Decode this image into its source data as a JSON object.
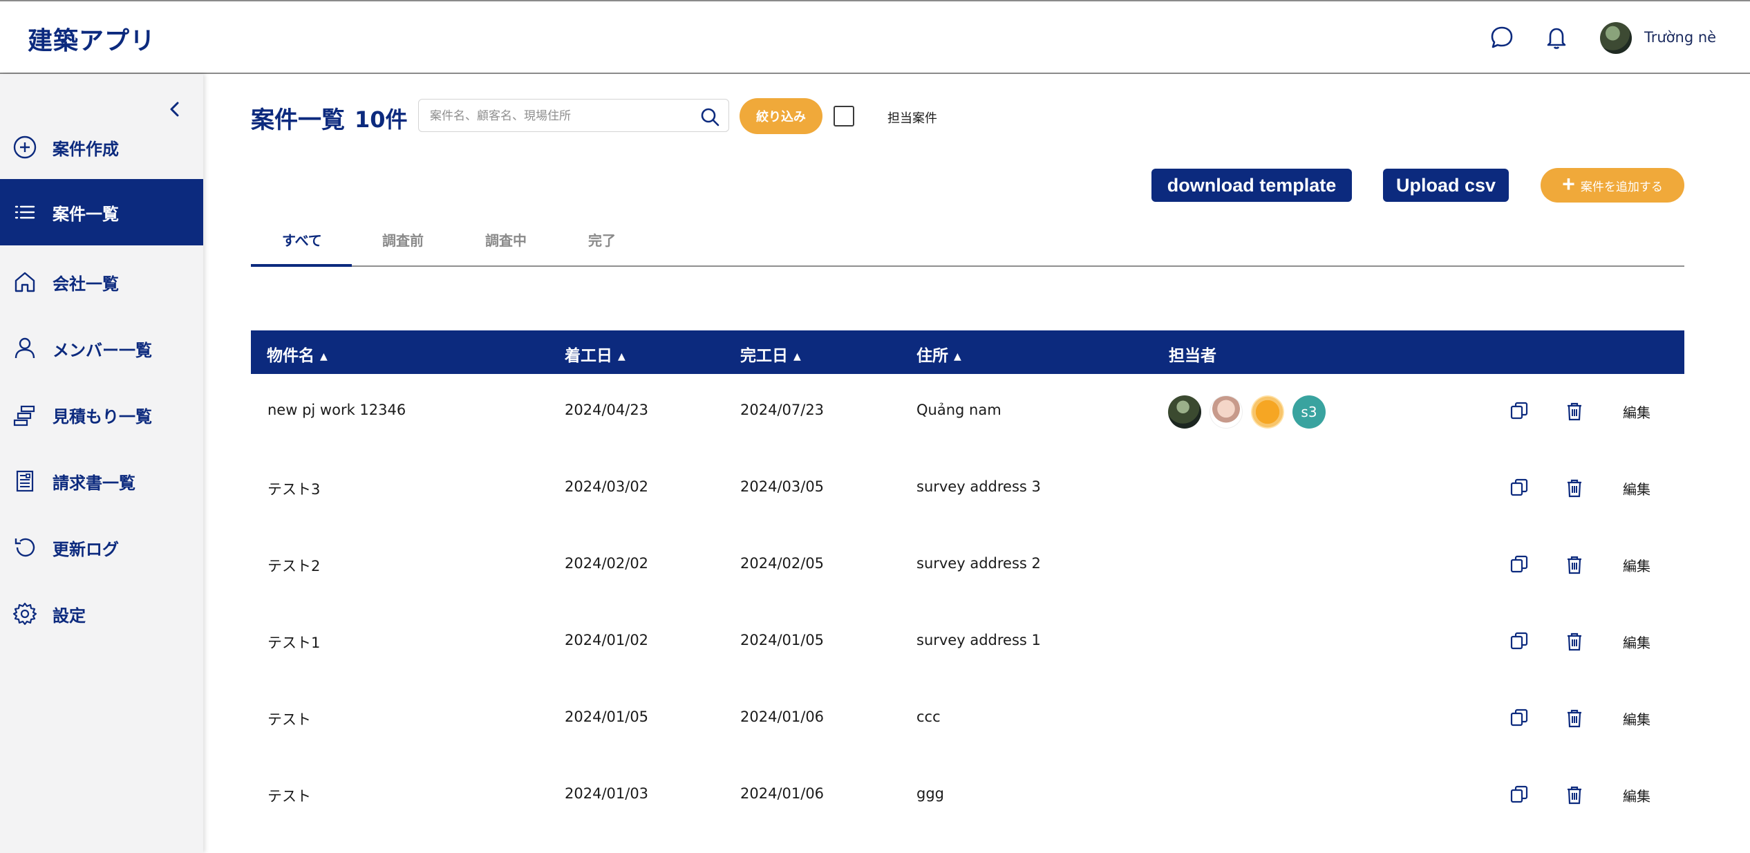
{
  "app": {
    "title": "建築アプリ"
  },
  "header": {
    "user_name": "Trường nè"
  },
  "sidebar": {
    "items": [
      {
        "label": "案件作成",
        "icon": "plus-circle-icon",
        "active": false
      },
      {
        "label": "案件一覧",
        "icon": "list-icon",
        "active": true
      },
      {
        "label": "会社一覧",
        "icon": "home-icon",
        "active": false
      },
      {
        "label": "メンバー一覧",
        "icon": "user-icon",
        "active": false
      },
      {
        "label": "見積もり一覧",
        "icon": "estimate-icon",
        "active": false
      },
      {
        "label": "請求書一覧",
        "icon": "invoice-icon",
        "active": false
      },
      {
        "label": "更新ログ",
        "icon": "history-icon",
        "active": false
      },
      {
        "label": "設定",
        "icon": "gear-icon",
        "active": false
      }
    ]
  },
  "main": {
    "title": "案件一覧",
    "count": "10件",
    "search_placeholder": "案件名、顧客名、現場住所",
    "filter_label": "絞り込み",
    "checkbox_label": "担当案件",
    "download_label": "download template",
    "upload_label": "Upload csv",
    "add_label": "案件を追加する",
    "tabs": [
      {
        "label": "すべて",
        "active": true
      },
      {
        "label": "調査前",
        "active": false
      },
      {
        "label": "調査中",
        "active": false
      },
      {
        "label": "完了",
        "active": false
      }
    ]
  },
  "table": {
    "headers": {
      "name": "物件名",
      "start": "着工日",
      "end": "完工日",
      "address": "住所",
      "assignee": "担当者"
    },
    "edit_label": "編集",
    "rows": [
      {
        "name": "new pj work 12346",
        "start": "2024/04/23",
        "end": "2024/07/23",
        "address": "Quảng nam",
        "assignee_badge": "s3"
      },
      {
        "name": "テスト3",
        "start": "2024/03/02",
        "end": "2024/03/05",
        "address": "survey address 3"
      },
      {
        "name": "テスト2",
        "start": "2024/02/02",
        "end": "2024/02/05",
        "address": "survey address 2"
      },
      {
        "name": "テスト1",
        "start": "2024/01/02",
        "end": "2024/01/05",
        "address": "survey address 1"
      },
      {
        "name": "テスト",
        "start": "2024/01/05",
        "end": "2024/01/06",
        "address": "ccc"
      },
      {
        "name": "テスト",
        "start": "2024/01/03",
        "end": "2024/01/06",
        "address": "ggg"
      }
    ]
  },
  "colors": {
    "navy": "#0c2a7e",
    "orange": "#f0a93a",
    "teal": "#39a39f"
  }
}
